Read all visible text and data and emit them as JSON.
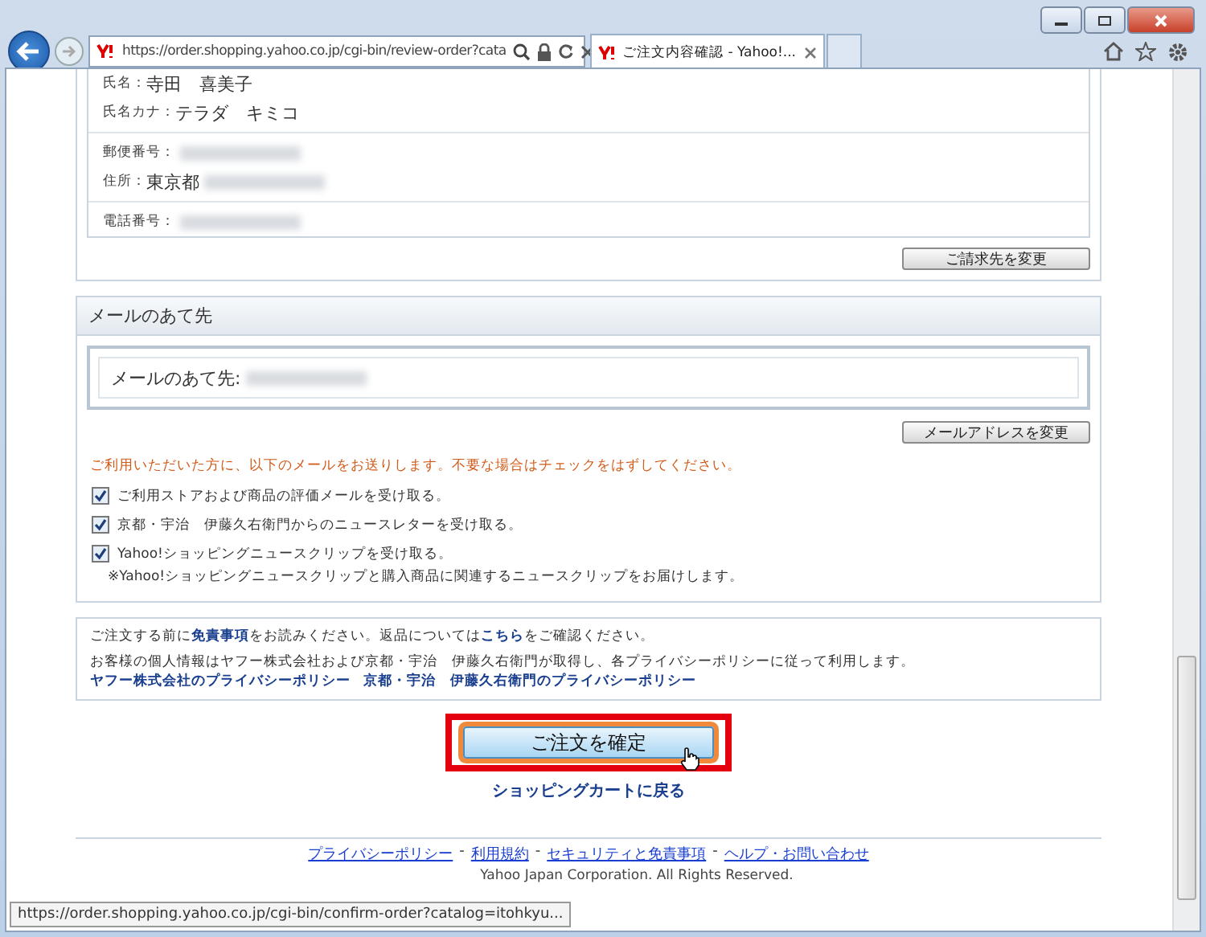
{
  "browser": {
    "url": "https://order.shopping.yahoo.co.jp/cgi-bin/review-order?cata",
    "tab_title": "ご注文内容確認 - Yahoo!...",
    "status_url": "https://order.shopping.yahoo.co.jp/cgi-bin/confirm-order?catalog=itohkyu..."
  },
  "billing": {
    "rows": [
      {
        "label": "氏名：",
        "value": "寺田　喜美子",
        "blurred": false,
        "divider_above": false
      },
      {
        "label": "氏名カナ：",
        "value": "テラダ　キミコ",
        "blurred": false,
        "divider_above": false
      },
      {
        "label": "郵便番号：",
        "blurred": true,
        "divider_above": true
      },
      {
        "label": "住所：",
        "value": "東京都",
        "blurred": true,
        "divider_above": false
      },
      {
        "label": "電話番号：",
        "blurred": true,
        "divider_above": true
      }
    ],
    "change_button": "ご請求先を変更"
  },
  "mail": {
    "title": "メールのあて先",
    "address_label": "メールのあて先:",
    "change_button": "メールアドレスを変更",
    "notice": "ご利用いただいた方に、以下のメールをお送りします。不要な場合はチェックをはずしてください。",
    "options": [
      {
        "label": "ご利用ストアおよび商品の評価メールを受け取る。",
        "checked": true
      },
      {
        "label": "京都・宇治　伊藤久右衛門からのニュースレターを受け取る。",
        "checked": true
      },
      {
        "label": "Yahoo!ショッピングニュースクリップを受け取る。",
        "note": "※Yahoo!ショッピングニュースクリップと購入商品に関連するニュースクリップをお届けします。",
        "checked": true
      }
    ]
  },
  "notice": {
    "line1": [
      "ご注文する前に",
      "免責事項",
      "をお読みください。返品については",
      "こちら",
      "をご確認ください。"
    ],
    "line2": "お客様の個人情報はヤフー株式会社および京都・宇治　伊藤久右衛門が取得し、各プライバシーポリシーに従って利用します。",
    "links": [
      "ヤフー株式会社のプライバシーポリシー",
      "京都・宇治　伊藤久右衛門のプライバシーポリシー"
    ]
  },
  "confirm_button": "ご注文を確定",
  "back_link": "ショッピングカートに戻る",
  "footer": {
    "links": [
      "プライバシーポリシー",
      "利用規約",
      "セキュリティと免責事項",
      "ヘルプ・お問い合わせ"
    ],
    "separator": "-",
    "copyright": "Yahoo Japan Corporation. All Rights Reserved."
  }
}
